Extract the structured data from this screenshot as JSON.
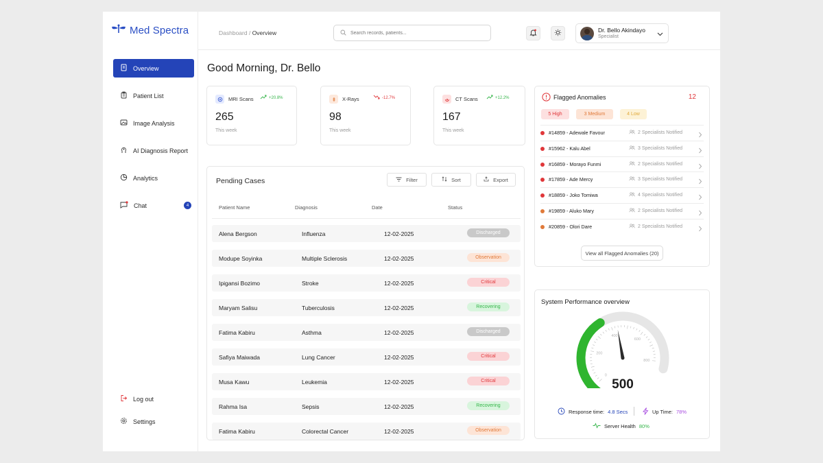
{
  "brand": {
    "name": "Med Spectra"
  },
  "nav": {
    "items": [
      {
        "label": "Overview",
        "icon": "document-icon",
        "active": true
      },
      {
        "label": "Patient List",
        "icon": "clipboard-icon"
      },
      {
        "label": "Image Analysis",
        "icon": "image-icon"
      },
      {
        "label": "AI Diagnosis Report",
        "icon": "ai-icon"
      },
      {
        "label": "Analytics",
        "icon": "pie-chart-icon"
      },
      {
        "label": "Chat",
        "icon": "chat-icon",
        "badge": "4"
      }
    ],
    "bottom": [
      {
        "label": "Log out",
        "icon": "logout-icon"
      },
      {
        "label": "Settings",
        "icon": "gear-icon"
      }
    ]
  },
  "header": {
    "breadcrumb_root": "Dashboard",
    "breadcrumb_sep": " / ",
    "breadcrumb_current": "Overview",
    "search_placeholder": "Search records, patients...",
    "user": {
      "name": "Dr. Bello Akindayo",
      "role": "Specialist"
    }
  },
  "greeting": "Good Morning, Dr. Bello",
  "stats": [
    {
      "label": "MRI Scans",
      "trend": "+20.8%",
      "direction": "up",
      "value": "265",
      "period": "This week",
      "accent": "#3a5bd0"
    },
    {
      "label": "X-Rays",
      "trend": "-12.7%",
      "direction": "down",
      "value": "98",
      "period": "This week",
      "accent": "#e07a3a"
    },
    {
      "label": "CT Scans",
      "trend": "+12.2%",
      "direction": "up",
      "value": "167",
      "period": "This week",
      "accent": "#e0373a"
    }
  ],
  "cases": {
    "title": "Pending Cases",
    "buttons": {
      "filter": "Filter",
      "sort": "Sort",
      "export": "Export"
    },
    "columns": [
      "Patient Name",
      "Diagnosis",
      "Date",
      "Status"
    ],
    "rows": [
      {
        "name": "Alena Bergson",
        "diagnosis": "Influenza",
        "date": "12-02-2025",
        "status": "Discharged"
      },
      {
        "name": "Modupe Soyinka",
        "diagnosis": "Multiple Sclerosis",
        "date": "12-02-2025",
        "status": "Observation"
      },
      {
        "name": "Ipigansi Bozimo",
        "diagnosis": "Stroke",
        "date": "12-02-2025",
        "status": "Critical"
      },
      {
        "name": "Maryam Salisu",
        "diagnosis": "Tuberculosis",
        "date": "12-02-2025",
        "status": "Recovering"
      },
      {
        "name": "Fatima Kabiru",
        "diagnosis": "Asthma",
        "date": "12-02-2025",
        "status": "Discharged"
      },
      {
        "name": "Safiya Maiwada",
        "diagnosis": "Lung Cancer",
        "date": "12-02-2025",
        "status": "Critical"
      },
      {
        "name": "Musa Kawu",
        "diagnosis": "Leukemia",
        "date": "12-02-2025",
        "status": "Critical"
      },
      {
        "name": "Rahma Isa",
        "diagnosis": "Sepsis",
        "date": "12-02-2025",
        "status": "Recovering"
      },
      {
        "name": "Fatima Kabiru",
        "diagnosis": "Colorectal Cancer",
        "date": "12-02-2025",
        "status": "Observation"
      }
    ],
    "status_colors": {
      "Discharged": {
        "bg": "#c9c9c9",
        "fg": "#ffffff"
      },
      "Observation": {
        "bg": "#fde4d6",
        "fg": "#e07a3a"
      },
      "Critical": {
        "bg": "#fbd3d5",
        "fg": "#e0373a"
      },
      "Recovering": {
        "bg": "#d8f5dd",
        "fg": "#35b54a"
      }
    }
  },
  "flagged": {
    "title": "Flagged Anomalies",
    "count": "12",
    "chips": [
      {
        "label": "5 High",
        "bg": "#fde0e0",
        "fg": "#e0373a"
      },
      {
        "label": "3 Medium",
        "bg": "#fde4d6",
        "fg": "#e07a3a"
      },
      {
        "label": "4 Low",
        "bg": "#fdf2d6",
        "fg": "#e0a93a"
      }
    ],
    "items": [
      {
        "label": "#14859 - Adewale Favour",
        "note": "2 Specialists Notified",
        "color": "#e0373a"
      },
      {
        "label": "#15962 - Kalu Abel",
        "note": "3 Specialists Notified",
        "color": "#e0373a"
      },
      {
        "label": "#16859 - Morayo Funmi",
        "note": "2 Specialists Notified",
        "color": "#e0373a"
      },
      {
        "label": "#17859 - Ade Mercy",
        "note": "3 Specialists Notified",
        "color": "#e0373a"
      },
      {
        "label": "#18859 - Joko Tomiwa",
        "note": "4 Specialists Notified",
        "color": "#e0373a"
      },
      {
        "label": "#19859 - Aluko Mary",
        "note": "2 Specialists Notified",
        "color": "#e07a3a"
      },
      {
        "label": "#20859 - Olori Dare",
        "note": "2 Specialists Notified",
        "color": "#e07a3a"
      }
    ],
    "view_all": "View all Flagged Anomalies (20)"
  },
  "performance": {
    "title": "System Performance overview",
    "gauge_value": "500",
    "gauge_fraction": 0.45,
    "gauge_ticks": [
      "0",
      "200",
      "400",
      "600",
      "800"
    ],
    "colors": {
      "fill": "#2fb52f",
      "track": "#e6e6e6"
    },
    "response_label": "Response time:",
    "response_value": "4.8 Secs",
    "uptime_label": "Up Time:",
    "uptime_value": "78%",
    "health_label": "Server Health",
    "health_value": "80%"
  }
}
